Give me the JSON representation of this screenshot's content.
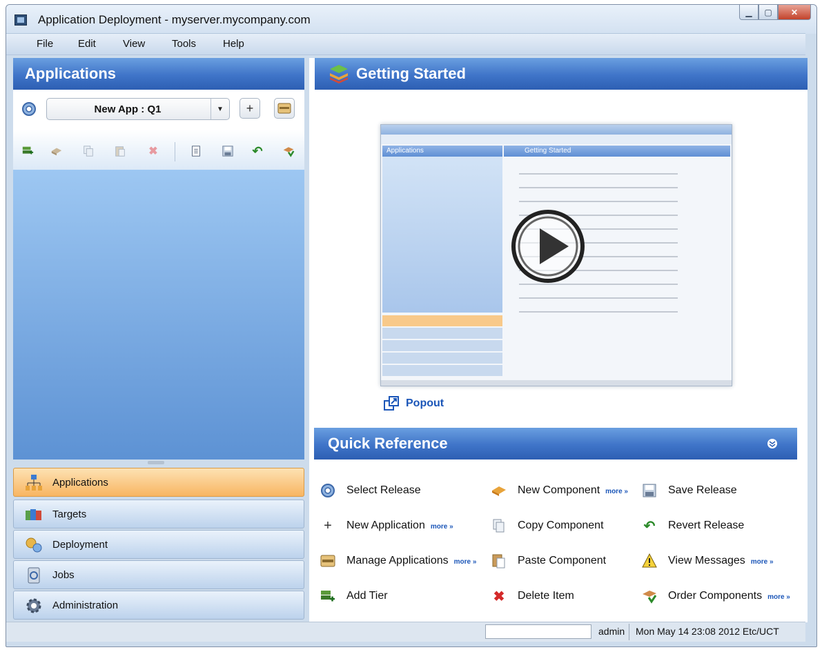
{
  "window": {
    "title": "Application Deployment - myserver.mycompany.com"
  },
  "menu": {
    "items": [
      "File",
      "Edit",
      "View",
      "Tools",
      "Help"
    ]
  },
  "left_panel": {
    "title": "Applications",
    "selected_app": "New App : Q1",
    "add_label": "+",
    "tree_items": []
  },
  "nav": {
    "items": [
      {
        "label": "Applications",
        "active": true
      },
      {
        "label": "Targets",
        "active": false
      },
      {
        "label": "Deployment",
        "active": false
      },
      {
        "label": "Jobs",
        "active": false
      },
      {
        "label": "Administration",
        "active": false
      }
    ]
  },
  "right_panel": {
    "title": "Getting Started",
    "video": {
      "inner_panel_title": "Applications",
      "inner_header_title": "Getting Started"
    },
    "popout_label": "Popout"
  },
  "quick_reference": {
    "title": "Quick Reference",
    "more_label": "more »",
    "items": [
      {
        "label": "Select Release",
        "icon": "select-release-icon",
        "more": false
      },
      {
        "label": "New Component",
        "icon": "new-component-icon",
        "more": true
      },
      {
        "label": "Save Release",
        "icon": "save-release-icon",
        "more": false
      },
      {
        "label": "New Application",
        "icon": "plus-icon",
        "more": true
      },
      {
        "label": "Copy Component",
        "icon": "copy-component-icon",
        "more": false
      },
      {
        "label": "Revert Release",
        "icon": "revert-icon",
        "more": false
      },
      {
        "label": "Manage Applications",
        "icon": "manage-applications-icon",
        "more": true
      },
      {
        "label": "Paste Component",
        "icon": "paste-component-icon",
        "more": false
      },
      {
        "label": "View Messages",
        "icon": "warning-icon",
        "more": true
      },
      {
        "label": "Add Tier",
        "icon": "add-tier-icon",
        "more": false
      },
      {
        "label": "Delete Item",
        "icon": "delete-icon",
        "more": false
      },
      {
        "label": "Order Components",
        "icon": "order-components-icon",
        "more": true
      }
    ]
  },
  "status": {
    "user": "admin",
    "timestamp": "Mon May 14 23:08 2012 Etc/UCT"
  },
  "colors": {
    "header_blue": "#3f74c8",
    "nav_active": "#f8b562",
    "link_blue": "#1b56b8"
  }
}
